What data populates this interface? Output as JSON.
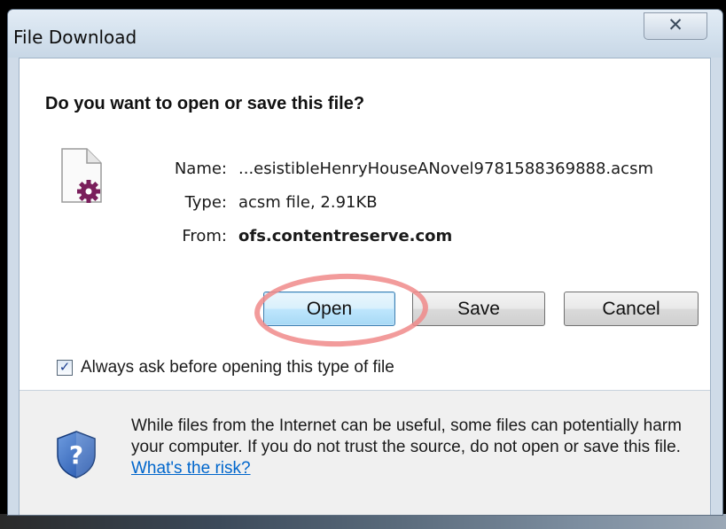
{
  "window": {
    "title": "File Download",
    "close_glyph": "☒"
  },
  "dialog": {
    "question": "Do you want to open or save this file?",
    "file_icon": "acsm-file-icon",
    "fields": {
      "name_label": "Name:",
      "name_value": "...esistibleHenryHouseANovel9781588369888.acsm",
      "type_label": "Type:",
      "type_value": "acsm file, 2.91KB",
      "from_label": "From:",
      "from_value": "ofs.contentreserve.com"
    },
    "buttons": {
      "open": "Open",
      "save": "Save",
      "cancel": "Cancel"
    },
    "always_ask": {
      "checked": true,
      "label": "Always ask before opening this type of file"
    }
  },
  "footer": {
    "shield_icon": "security-shield-icon",
    "warning_text": "While files from the Internet can be useful, some files can potentially harm your computer. If you do not trust the source, do not open or save this file.",
    "risk_link": "What's the risk?"
  },
  "colors": {
    "highlight": "#f08a8a",
    "link": "#0066cc",
    "open_button_border": "#3c7fb1"
  }
}
